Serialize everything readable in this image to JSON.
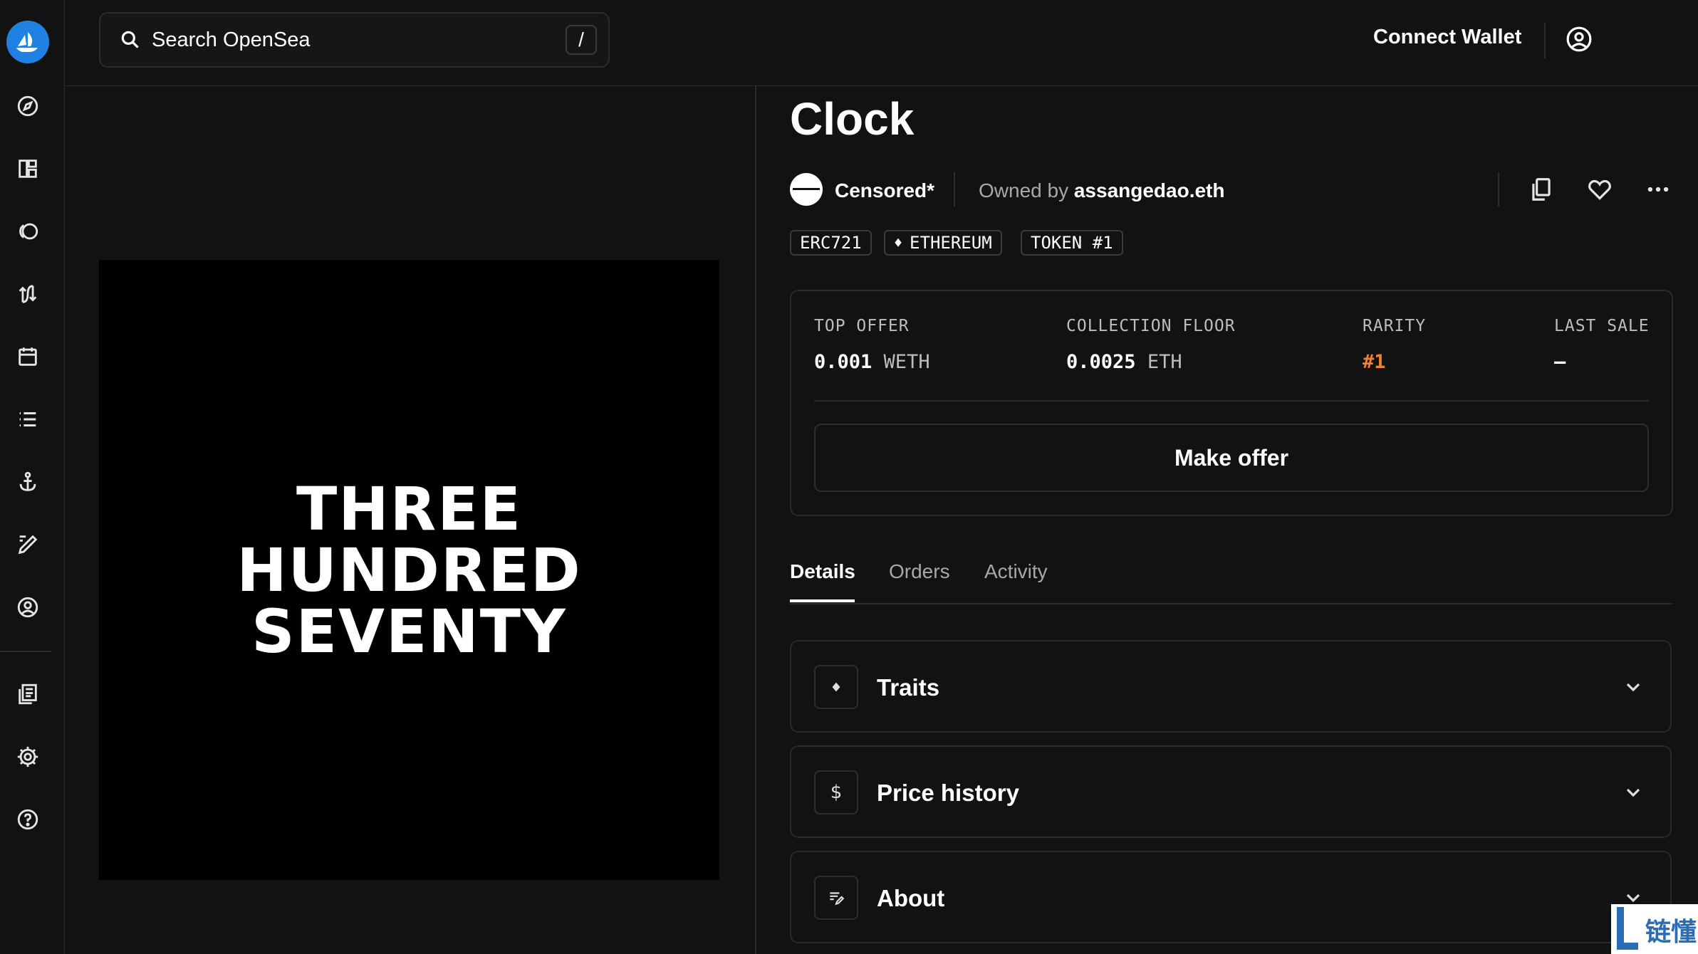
{
  "search": {
    "placeholder": "Search OpenSea",
    "shortcut": "/"
  },
  "header": {
    "connect_wallet": "Connect Wallet"
  },
  "sidebar": {
    "items": [
      {
        "icon": "compass-icon"
      },
      {
        "icon": "dashboard-icon"
      },
      {
        "icon": "collections-icon"
      },
      {
        "icon": "swap-icon"
      },
      {
        "icon": "calendar-icon"
      },
      {
        "icon": "list-icon"
      },
      {
        "icon": "anchor-icon"
      },
      {
        "icon": "create-icon"
      },
      {
        "icon": "profile-icon"
      },
      {
        "icon": "docs-icon"
      },
      {
        "icon": "settings-icon"
      },
      {
        "icon": "help-icon"
      }
    ]
  },
  "artwork": {
    "line1": "THREE",
    "line2": "HUNDRED",
    "line3": "SEVENTY"
  },
  "item": {
    "title": "Clock",
    "collection": "Censored*",
    "owned_prefix": "Owned by",
    "owner": "assangedao.eth",
    "chips": [
      "ERC721",
      "ETHEREUM",
      "TOKEN #1"
    ]
  },
  "stats": {
    "top_offer_label": "TOP OFFER",
    "top_offer_value": "0.001",
    "top_offer_unit": "WETH",
    "floor_label": "COLLECTION FLOOR",
    "floor_value": "0.0025",
    "floor_unit": "ETH",
    "rarity_label": "RARITY",
    "rarity_value": "#1",
    "last_sale_label": "LAST SALE",
    "last_sale_value": "–"
  },
  "make_offer": "Make offer",
  "tabs": [
    "Details",
    "Orders",
    "Activity"
  ],
  "accordions": [
    {
      "title": "Traits",
      "icon": "diamond-icon"
    },
    {
      "title": "Price history",
      "icon": "dollar-icon"
    },
    {
      "title": "About",
      "icon": "about-icon"
    }
  ],
  "watermark": {
    "text": "链懂"
  },
  "colors": {
    "brand": "#2081e2",
    "rarity": "#f2812e",
    "background": "#121212"
  }
}
